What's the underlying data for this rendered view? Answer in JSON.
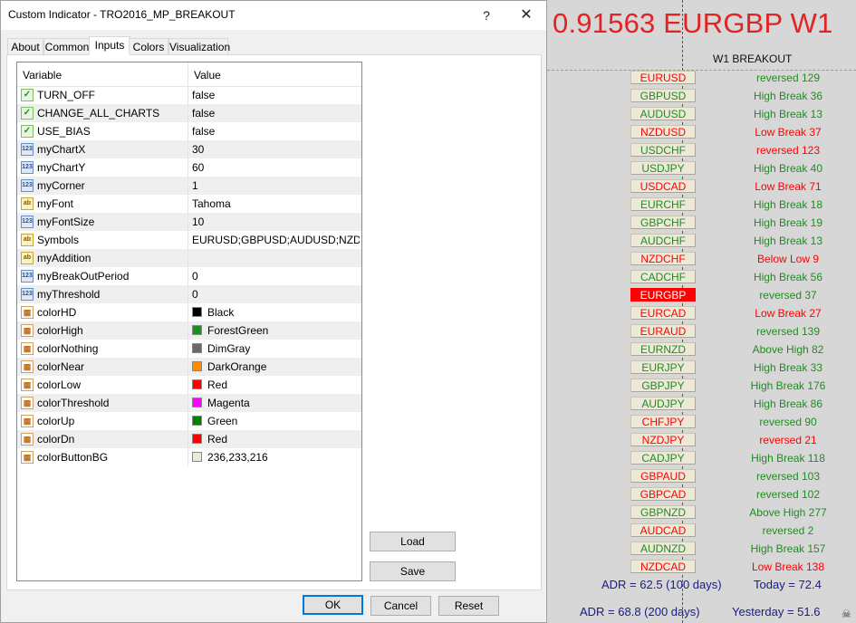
{
  "dialog": {
    "title": "Custom Indicator - TRO2016_MP_BREAKOUT",
    "help_label": "?",
    "close_label": "✕",
    "tabs": [
      "About",
      "Common",
      "Inputs",
      "Colors",
      "Visualization"
    ],
    "active_tab": "Inputs",
    "grid_headers": {
      "variable": "Variable",
      "value": "Value"
    },
    "params": [
      {
        "icon": "bool",
        "name": "TURN_OFF",
        "value": "false"
      },
      {
        "icon": "bool",
        "name": "CHANGE_ALL_CHARTS",
        "value": "false"
      },
      {
        "icon": "bool",
        "name": "USE_BIAS",
        "value": "false"
      },
      {
        "icon": "num",
        "name": "myChartX",
        "value": "30"
      },
      {
        "icon": "num",
        "name": "myChartY",
        "value": "60"
      },
      {
        "icon": "num",
        "name": "myCorner",
        "value": "1"
      },
      {
        "icon": "str",
        "name": "myFont",
        "value": "Tahoma"
      },
      {
        "icon": "num",
        "name": "myFontSize",
        "value": "10"
      },
      {
        "icon": "str",
        "name": "Symbols",
        "value": "EURUSD;GBPUSD;AUDUSD;NZD..."
      },
      {
        "icon": "str",
        "name": "myAddition",
        "value": ""
      },
      {
        "icon": "num",
        "name": "myBreakOutPeriod",
        "value": "0"
      },
      {
        "icon": "num",
        "name": "myThreshold",
        "value": "0"
      },
      {
        "icon": "clr",
        "name": "colorHD",
        "value": "Black",
        "swatch": "#000000"
      },
      {
        "icon": "clr",
        "name": "colorHigh",
        "value": "ForestGreen",
        "swatch": "#228b22"
      },
      {
        "icon": "clr",
        "name": "colorNothing",
        "value": "DimGray",
        "swatch": "#696969"
      },
      {
        "icon": "clr",
        "name": "colorNear",
        "value": "DarkOrange",
        "swatch": "#ff8c00"
      },
      {
        "icon": "clr",
        "name": "colorLow",
        "value": "Red",
        "swatch": "#ff0000"
      },
      {
        "icon": "clr",
        "name": "colorThreshold",
        "value": "Magenta",
        "swatch": "#ff00ff"
      },
      {
        "icon": "clr",
        "name": "colorUp",
        "value": "Green",
        "swatch": "#008000"
      },
      {
        "icon": "clr",
        "name": "colorDn",
        "value": "Red",
        "swatch": "#ff0000"
      },
      {
        "icon": "clr",
        "name": "colorButtonBG",
        "value": "236,233,216",
        "swatch": "#ece9d8"
      }
    ],
    "buttons": {
      "load": "Load",
      "save": "Save",
      "ok": "OK",
      "cancel": "Cancel",
      "reset": "Reset"
    }
  },
  "chart": {
    "title": "0.91563 EURGBP W1",
    "subtitle": "W1 BREAKOUT",
    "active_pair": "EURGBP",
    "pairs": [
      {
        "symbol": "EURUSD",
        "symbol_color": "#ff0000",
        "status": "reversed 129",
        "status_color": "#228b22"
      },
      {
        "symbol": "GBPUSD",
        "symbol_color": "#228b22",
        "status": "High Break 36",
        "status_color": "#228b22"
      },
      {
        "symbol": "AUDUSD",
        "symbol_color": "#228b22",
        "status": "High Break 13",
        "status_color": "#228b22"
      },
      {
        "symbol": "NZDUSD",
        "symbol_color": "#ff0000",
        "status": "Low Break 37",
        "status_color": "#ff0000"
      },
      {
        "symbol": "USDCHF",
        "symbol_color": "#228b22",
        "status": "reversed 123",
        "status_color": "#ff0000"
      },
      {
        "symbol": "USDJPY",
        "symbol_color": "#228b22",
        "status": "High Break 40",
        "status_color": "#228b22"
      },
      {
        "symbol": "USDCAD",
        "symbol_color": "#ff0000",
        "status": "Low Break 71",
        "status_color": "#ff0000"
      },
      {
        "symbol": "EURCHF",
        "symbol_color": "#228b22",
        "status": "High Break 18",
        "status_color": "#228b22"
      },
      {
        "symbol": "GBPCHF",
        "symbol_color": "#228b22",
        "status": "High Break 19",
        "status_color": "#228b22"
      },
      {
        "symbol": "AUDCHF",
        "symbol_color": "#228b22",
        "status": "High Break 13",
        "status_color": "#228b22"
      },
      {
        "symbol": "NZDCHF",
        "symbol_color": "#ff0000",
        "status": "Below Low 9",
        "status_color": "#ff0000"
      },
      {
        "symbol": "CADCHF",
        "symbol_color": "#228b22",
        "status": "High Break 56",
        "status_color": "#228b22"
      },
      {
        "symbol": "EURGBP",
        "symbol_color": "#ffffff",
        "status": "reversed 37",
        "status_color": "#228b22"
      },
      {
        "symbol": "EURCAD",
        "symbol_color": "#ff0000",
        "status": "Low Break 27",
        "status_color": "#ff0000"
      },
      {
        "symbol": "EURAUD",
        "symbol_color": "#ff0000",
        "status": "reversed 139",
        "status_color": "#228b22"
      },
      {
        "symbol": "EURNZD",
        "symbol_color": "#228b22",
        "status": "Above High 82",
        "status_color": "#228b22"
      },
      {
        "symbol": "EURJPY",
        "symbol_color": "#228b22",
        "status": "High Break 33",
        "status_color": "#228b22"
      },
      {
        "symbol": "GBPJPY",
        "symbol_color": "#228b22",
        "status": "High Break 176",
        "status_color": "#228b22"
      },
      {
        "symbol": "AUDJPY",
        "symbol_color": "#228b22",
        "status": "High Break 86",
        "status_color": "#228b22"
      },
      {
        "symbol": "CHFJPY",
        "symbol_color": "#ff0000",
        "status": "reversed 90",
        "status_color": "#228b22"
      },
      {
        "symbol": "NZDJPY",
        "symbol_color": "#ff0000",
        "status": "reversed 21",
        "status_color": "#ff0000"
      },
      {
        "symbol": "CADJPY",
        "symbol_color": "#228b22",
        "status": "High Break 118",
        "status_color": "#228b22"
      },
      {
        "symbol": "GBPAUD",
        "symbol_color": "#ff0000",
        "status": "reversed 103",
        "status_color": "#228b22"
      },
      {
        "symbol": "GBPCAD",
        "symbol_color": "#ff0000",
        "status": "reversed 102",
        "status_color": "#228b22"
      },
      {
        "symbol": "GBPNZD",
        "symbol_color": "#228b22",
        "status": "Above High 277",
        "status_color": "#228b22"
      },
      {
        "symbol": "AUDCAD",
        "symbol_color": "#ff0000",
        "status": "reversed 2",
        "status_color": "#228b22"
      },
      {
        "symbol": "AUDNZD",
        "symbol_color": "#228b22",
        "status": "High Break 157",
        "status_color": "#228b22"
      },
      {
        "symbol": "NZDCAD",
        "symbol_color": "#ff0000",
        "status": "Low Break 138",
        "status_color": "#ff0000"
      }
    ],
    "adr_100": "ADR = 62.5  (100 days)",
    "today": "Today = 72.4",
    "adr_200": "ADR = 68.8  (200 days)",
    "yesterday": "Yesterday = 51.6",
    "skull_icon": "☠"
  }
}
